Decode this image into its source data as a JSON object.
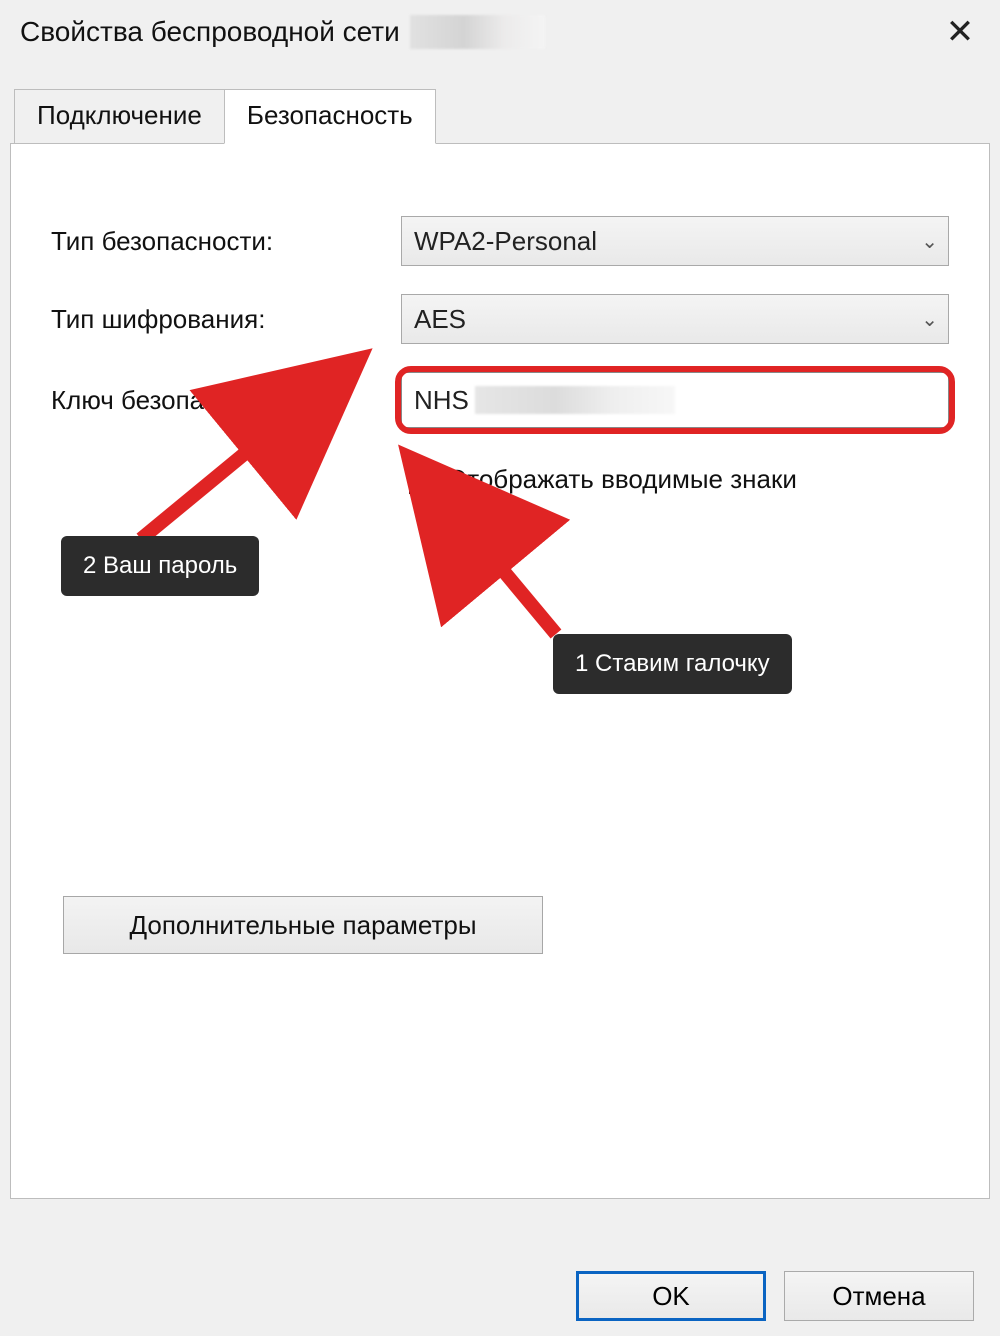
{
  "window": {
    "title": "Свойства беспроводной сети"
  },
  "tabs": {
    "connection": "Подключение",
    "security": "Безопасность"
  },
  "form": {
    "security_type_label": "Тип безопасности:",
    "security_type_value": "WPA2-Personal",
    "encryption_type_label": "Тип шифрования:",
    "encryption_type_value": "AES",
    "network_key_label": "Ключ безопасности сети",
    "network_key_value": "NHS",
    "show_chars_label": "Отображать вводимые знаки",
    "advanced_button": "Дополнительные параметры"
  },
  "annotations": {
    "tooltip_password": "2 Ваш пароль",
    "tooltip_checkbox": "1 Ставим галочку"
  },
  "buttons": {
    "ok": "OK",
    "cancel": "Отмена"
  }
}
